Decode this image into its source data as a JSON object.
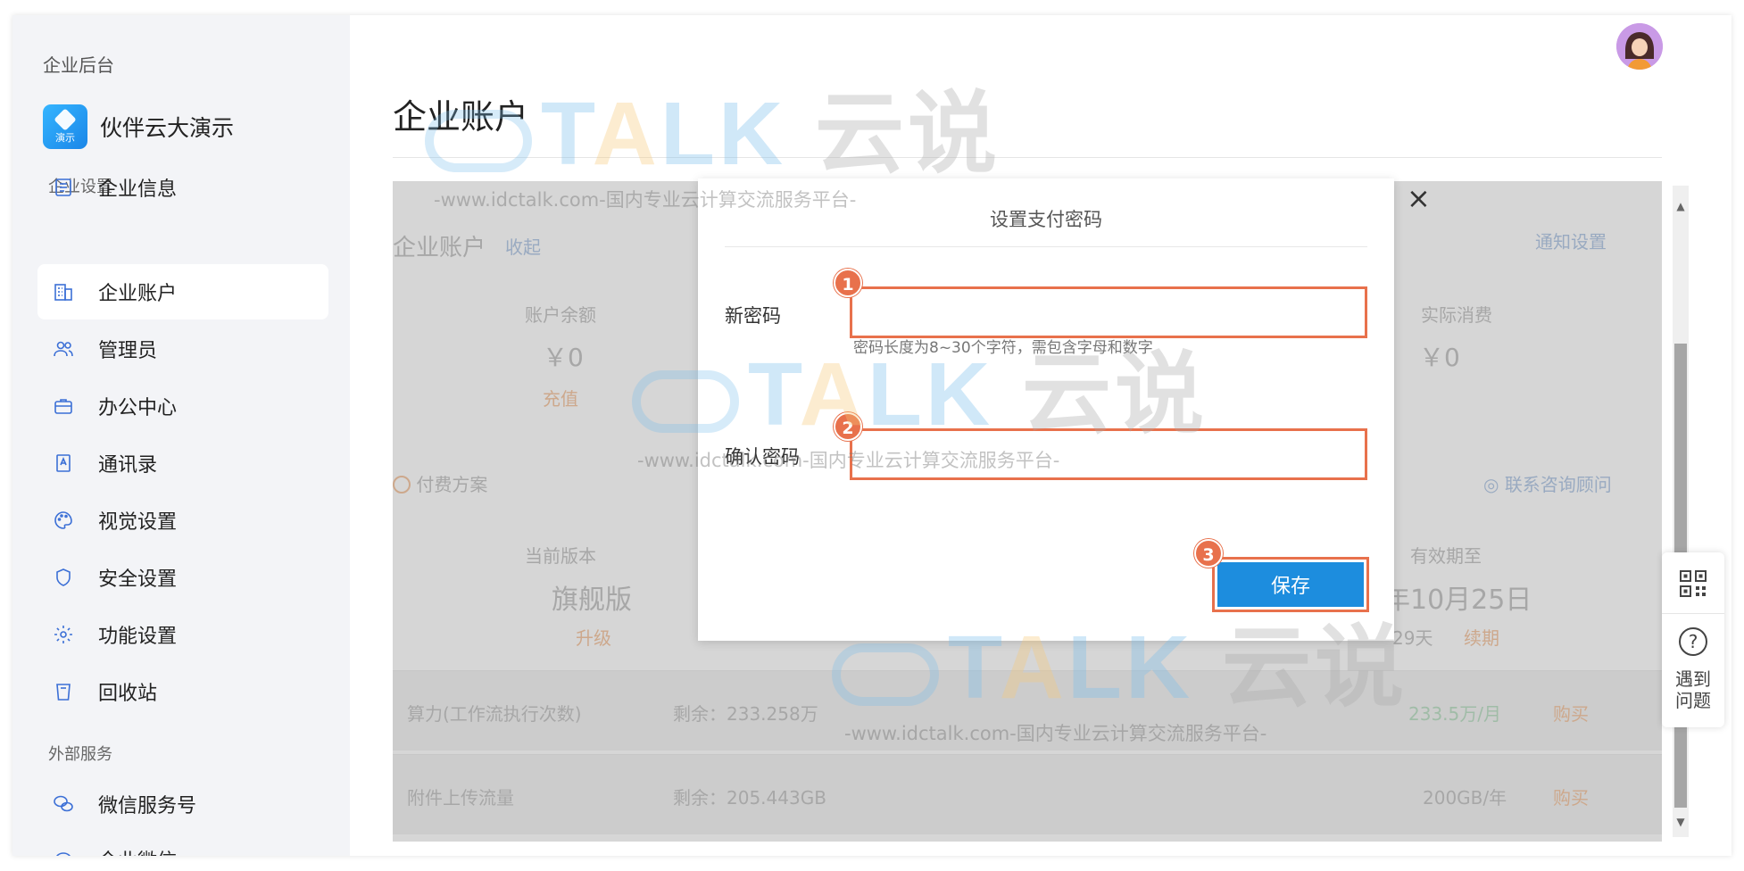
{
  "sidebar": {
    "title": "企业后台",
    "brand": {
      "name": "伙伴云大演示",
      "logo_tag": "演示"
    },
    "section_company": "企业设置",
    "section_external": "外部服务",
    "items": [
      {
        "label": "企业信息",
        "icon": "document-icon"
      },
      {
        "label": "企业账户",
        "icon": "building-icon"
      },
      {
        "label": "管理员",
        "icon": "users-icon"
      },
      {
        "label": "办公中心",
        "icon": "briefcase-icon"
      },
      {
        "label": "通讯录",
        "icon": "contact-book-icon"
      },
      {
        "label": "视觉设置",
        "icon": "palette-icon"
      },
      {
        "label": "安全设置",
        "icon": "shield-icon"
      },
      {
        "label": "功能设置",
        "icon": "gear-icon"
      },
      {
        "label": "回收站",
        "icon": "trash-icon"
      },
      {
        "label": "微信服务号",
        "icon": "wechat-icon"
      },
      {
        "label": "企业微信",
        "icon": "wecom-icon"
      }
    ]
  },
  "header": {
    "title": "企业账户"
  },
  "content": {
    "section_title": "企业账户",
    "collapse": "收起",
    "notify": "通知设置",
    "balance_label": "账户余额",
    "balance_value": "￥0",
    "recharge": "充值",
    "actual_label": "实际消费",
    "actual_value": "￥0",
    "plan_title": "付费方案",
    "consult": "联系咨询顾问",
    "version_label": "当前版本",
    "version_value": "旗舰版",
    "upgrade": "升级",
    "expiry_label": "有效期至",
    "expiry_value": "年10月25日",
    "remain_days": "29天",
    "renew": "续期",
    "rows": [
      {
        "name": "算力(工作流执行次数)",
        "remain": "剩余：233.258万",
        "plan": "233.5万/月",
        "buy": "购买"
      },
      {
        "name": "附件上传流量",
        "remain": "剩余：205.443GB",
        "plan": "200GB/年",
        "buy": "购买"
      }
    ]
  },
  "modal": {
    "title": "设置支付密码",
    "close": "×",
    "new_password_label": "新密码",
    "new_password_value": "",
    "hint": "密码长度为8~30个字符，需包含字母和数字",
    "confirm_label": "确认密码",
    "confirm_value": "",
    "save": "保存",
    "badges": [
      "1",
      "2",
      "3"
    ]
  },
  "float": {
    "help": "遇到问题"
  },
  "watermark": {
    "t": "T",
    "a": "A",
    "lk": "LK",
    "cn": "云说",
    "sub": "-www.idctalk.com-国内专业云计算交流服务平台-"
  },
  "colors": {
    "accent": "#1d8dde",
    "highlight": "#e8714c",
    "sidebar_bg": "#f3f4f7"
  }
}
